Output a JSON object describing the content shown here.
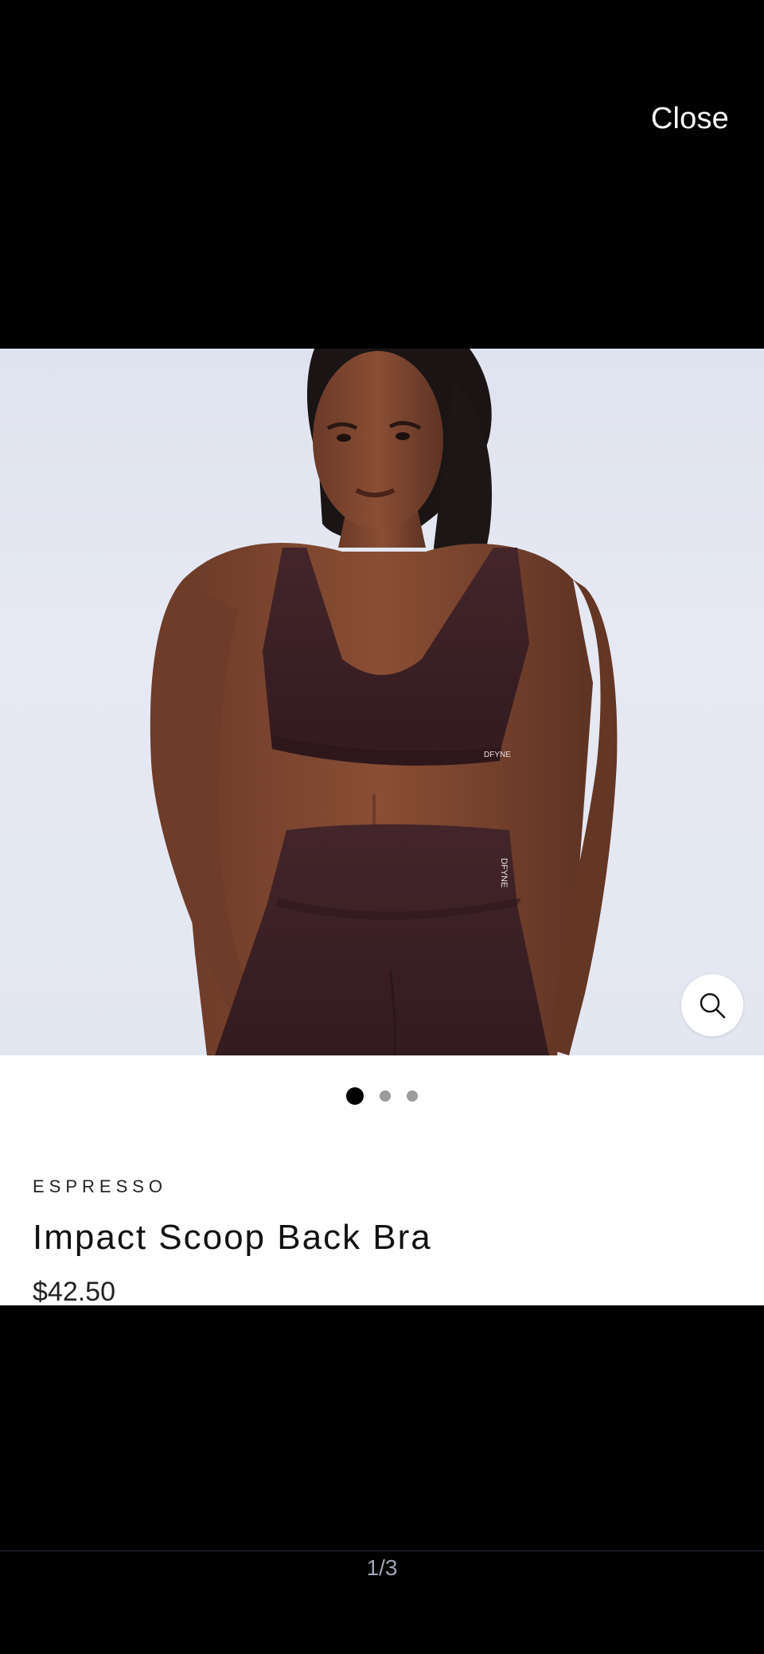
{
  "header": {
    "close_label": "Close"
  },
  "gallery": {
    "current_index": 1,
    "total_images": 3,
    "counter_label": "1/3",
    "image_logo_text": "DFYNE"
  },
  "product": {
    "variant": "ESPRESSO",
    "title": "Impact Scoop Back Bra",
    "price": "$42.50"
  },
  "icons": {
    "zoom": "magnifier-icon"
  },
  "colors": {
    "background": "#000000",
    "product_color": "#3a1f22",
    "active_dot": "#000000",
    "inactive_dot": "#9b9b9b"
  }
}
